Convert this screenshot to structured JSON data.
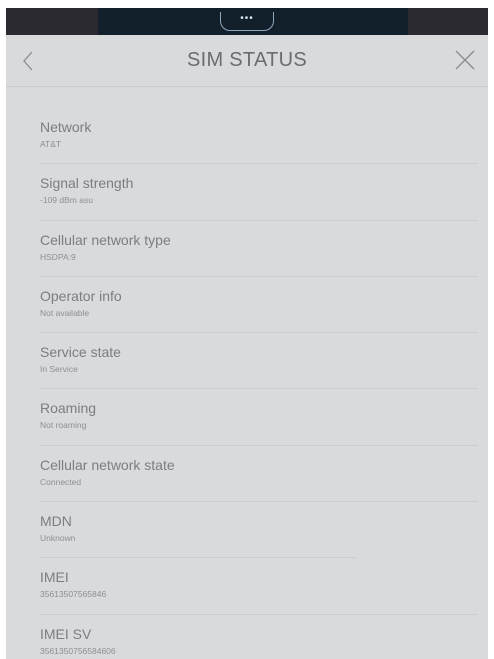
{
  "header": {
    "title": "SIM STATUS"
  },
  "status_items": [
    {
      "label": "Network",
      "value": "AT&T"
    },
    {
      "label": "Signal strength",
      "value": "-109 dBm asu"
    },
    {
      "label": "Cellular network type",
      "value": "HSDPA:9"
    },
    {
      "label": "Operator info",
      "value": "Not available"
    },
    {
      "label": "Service state",
      "value": "In Service"
    },
    {
      "label": "Roaming",
      "value": "Not roaming"
    },
    {
      "label": "Cellular network state",
      "value": "Connected"
    },
    {
      "label": "MDN",
      "value": "Unknown"
    },
    {
      "label": "IMEI",
      "value": "35613507565846"
    },
    {
      "label": "IMEI SV",
      "value": "3561350756584606"
    }
  ],
  "icons": {
    "back": "chevron-left-icon",
    "close": "close-icon",
    "handle": "pull-down-handle"
  },
  "colors": {
    "screen_background": "#d9dadc",
    "system_bar": "#12202c",
    "text_primary": "#7c7d80",
    "text_secondary": "#8e8f92"
  }
}
